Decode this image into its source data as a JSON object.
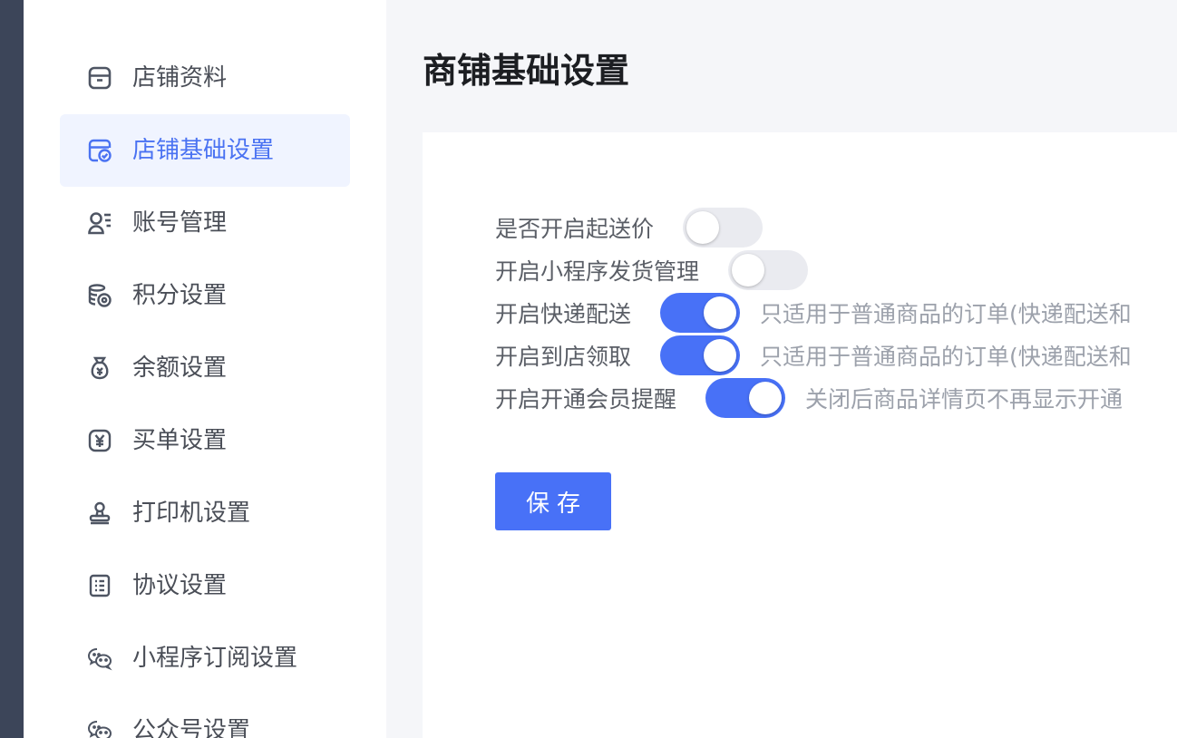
{
  "sidebar": {
    "items": [
      {
        "label": "店铺资料",
        "icon": "store-icon",
        "active": false
      },
      {
        "label": "店铺基础设置",
        "icon": "store-check-icon",
        "active": true
      },
      {
        "label": "账号管理",
        "icon": "user-list-icon",
        "active": false
      },
      {
        "label": "积分设置",
        "icon": "coins-icon",
        "active": false
      },
      {
        "label": "余额设置",
        "icon": "money-bag-icon",
        "active": false
      },
      {
        "label": "买单设置",
        "icon": "yen-icon",
        "active": false
      },
      {
        "label": "打印机设置",
        "icon": "stamp-icon",
        "active": false
      },
      {
        "label": "协议设置",
        "icon": "document-list-icon",
        "active": false
      },
      {
        "label": "小程序订阅设置",
        "icon": "wechat-icon",
        "active": false
      },
      {
        "label": "公众号设置",
        "icon": "wechat-icon",
        "active": false
      }
    ]
  },
  "main": {
    "title": "商铺基础设置",
    "settings": [
      {
        "label": "是否开启起送价",
        "enabled": false,
        "hint": ""
      },
      {
        "label": "开启小程序发货管理",
        "enabled": false,
        "hint": ""
      },
      {
        "label": "开启快递配送",
        "enabled": true,
        "hint": "只适用于普通商品的订单(快递配送和"
      },
      {
        "label": "开启到店领取",
        "enabled": true,
        "hint": "只适用于普通商品的订单(快递配送和"
      },
      {
        "label": "开启开通会员提醒",
        "enabled": true,
        "hint": "关闭后商品详情页不再显示开通"
      }
    ],
    "save_label": "保存"
  },
  "colors": {
    "accent": "#4871f7",
    "active_menu_bg": "#f0f4ff",
    "switch_off": "#eaebf0",
    "side_strip": "#3c4559"
  }
}
